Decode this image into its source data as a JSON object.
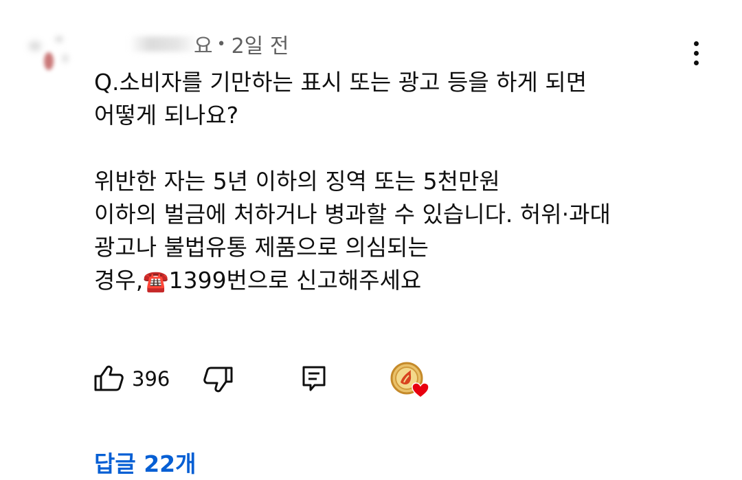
{
  "comment": {
    "author_visible_fragment": "요",
    "separator": "•",
    "timestamp": "2일 전",
    "body_lines": [
      "Q.소비자를 기만하는 표시 또는 광고 등을 하게 되면",
      "어떻게 되나요?",
      "",
      "위반한 자는 5년 이하의 징역 또는 5천만원",
      "이하의 벌금에 처하거나 병과할 수 있습니다. 허위·과대",
      "광고나 불법유통 제품으로 의심되는",
      "경우,"
    ],
    "last_line_emoji": "☎️",
    "last_line_rest": "1399번으로 신고해주세요"
  },
  "actions": {
    "like_count": "396",
    "like_icon": "thumbs-up-icon",
    "dislike_icon": "thumbs-down-icon",
    "reply_icon": "reply-icon",
    "creator_heart_icon": "creator-heart-icon"
  },
  "replies": {
    "label": "답글 22개"
  },
  "colors": {
    "link": "#065fd4",
    "text": "#0f0f0f",
    "meta": "#606060",
    "heart": "#e8000f"
  }
}
